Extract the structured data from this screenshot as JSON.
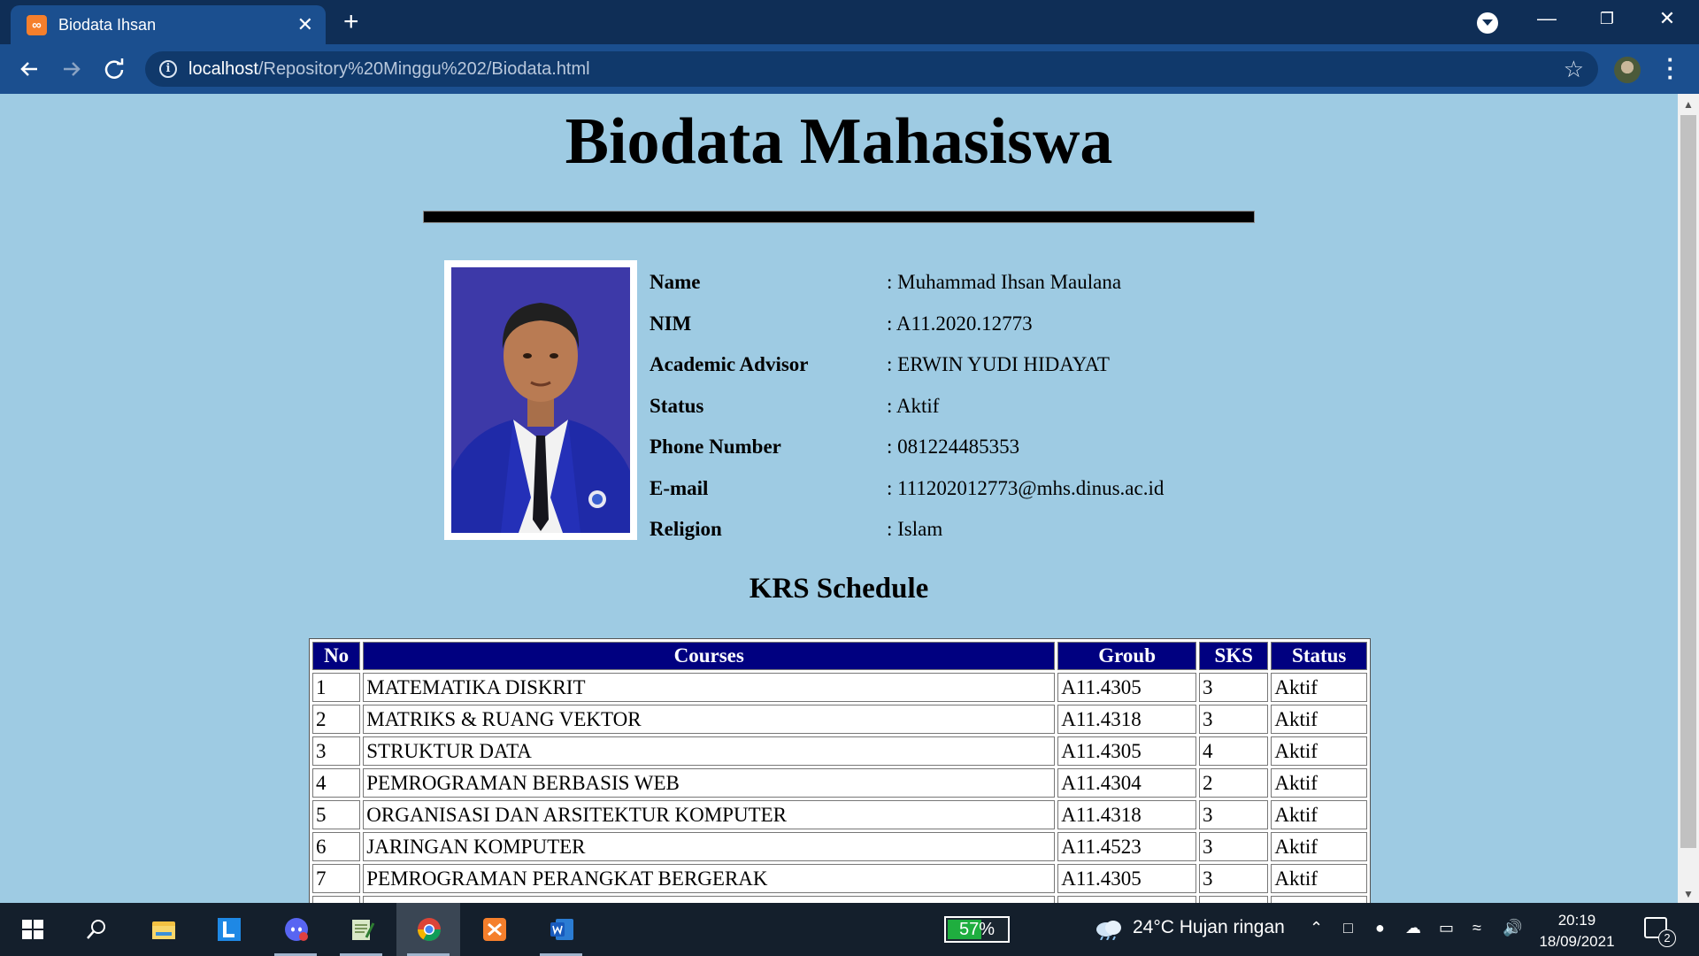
{
  "browser": {
    "tab_title": "Biodata Ihsan",
    "tab_favicon": "xampp-icon",
    "url_host": "localhost",
    "url_path": "/Repository%20Minggu%202/Biodata.html"
  },
  "page": {
    "title": "Biodata Mahasiswa",
    "photo_alt": "student-photo",
    "bio": [
      {
        "label": "Name",
        "value": ": Muhammad Ihsan Maulana"
      },
      {
        "label": "NIM",
        "value": ": A11.2020.12773"
      },
      {
        "label": "Academic Advisor",
        "value": ": ERWIN YUDI HIDAYAT"
      },
      {
        "label": "Status",
        "value": ": Aktif"
      },
      {
        "label": "Phone Number",
        "value": ": 081224485353"
      },
      {
        "label": "E-mail",
        "value": ": 111202012773@mhs.dinus.ac.id"
      },
      {
        "label": "Religion",
        "value": ": Islam"
      }
    ],
    "krs_title": "KRS Schedule",
    "krs_headers": [
      "No",
      "Courses",
      "Groub",
      "SKS",
      "Status"
    ],
    "krs_rows": [
      [
        "1",
        "MATEMATIKA DISKRIT",
        "A11.4305",
        "3",
        "Aktif"
      ],
      [
        "2",
        "MATRIKS & RUANG VEKTOR",
        "A11.4318",
        "3",
        "Aktif"
      ],
      [
        "3",
        "STRUKTUR DATA",
        "A11.4305",
        "4",
        "Aktif"
      ],
      [
        "4",
        "PEMROGRAMAN BERBASIS WEB",
        "A11.4304",
        "2",
        "Aktif"
      ],
      [
        "5",
        "ORGANISASI DAN ARSITEKTUR KOMPUTER",
        "A11.4318",
        "3",
        "Aktif"
      ],
      [
        "6",
        "JARINGAN KOMPUTER",
        "A11.4523",
        "3",
        "Aktif"
      ],
      [
        "7",
        "PEMROGRAMAN PERANGKAT BERGERAK",
        "A11.4305",
        "3",
        "Aktif"
      ]
    ]
  },
  "taskbar": {
    "battery_percent": "57%",
    "battery_level": 0.57,
    "weather": "24°C  Hujan ringan",
    "time": "20:19",
    "date": "18/09/2021",
    "notification_count": "2",
    "apps": [
      "start-icon",
      "search-icon",
      "file-explorer-icon",
      "app-l-icon",
      "discord-icon",
      "notepad-icon",
      "chrome-icon",
      "xampp-icon",
      "word-icon"
    ]
  },
  "colors": {
    "page_bg": "#9ecbe3",
    "table_header_bg": "#000080",
    "browser_frame": "#0f2e56",
    "toolbar": "#1b4f8f"
  }
}
